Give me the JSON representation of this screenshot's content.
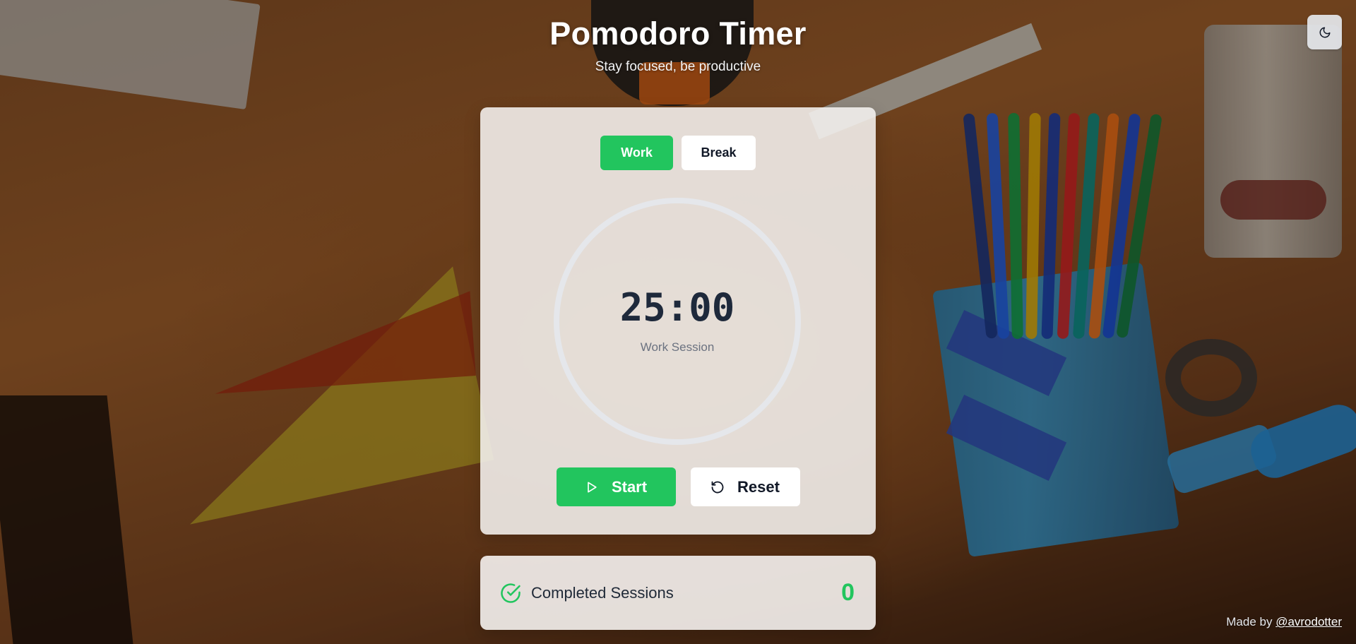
{
  "header": {
    "title": "Pomodoro Timer",
    "subtitle": "Stay focused, be productive"
  },
  "theme_toggle": {
    "icon": "moon-icon"
  },
  "modes": {
    "work_label": "Work",
    "break_label": "Break",
    "active": "Work"
  },
  "timer": {
    "time": "25:00",
    "session_label": "Work Session",
    "progress": 0
  },
  "controls": {
    "start_label": "Start",
    "start_icon": "play-icon",
    "reset_label": "Reset",
    "reset_icon": "rotate-ccw-icon"
  },
  "sessions": {
    "label": "Completed Sessions",
    "icon": "check-circle-icon",
    "count": "0"
  },
  "footer": {
    "prefix": "Made by",
    "link_text": "@avrodotter"
  },
  "colors": {
    "accent": "#22c55e",
    "timer_text": "#1e293b",
    "muted_text": "#6b7280"
  }
}
